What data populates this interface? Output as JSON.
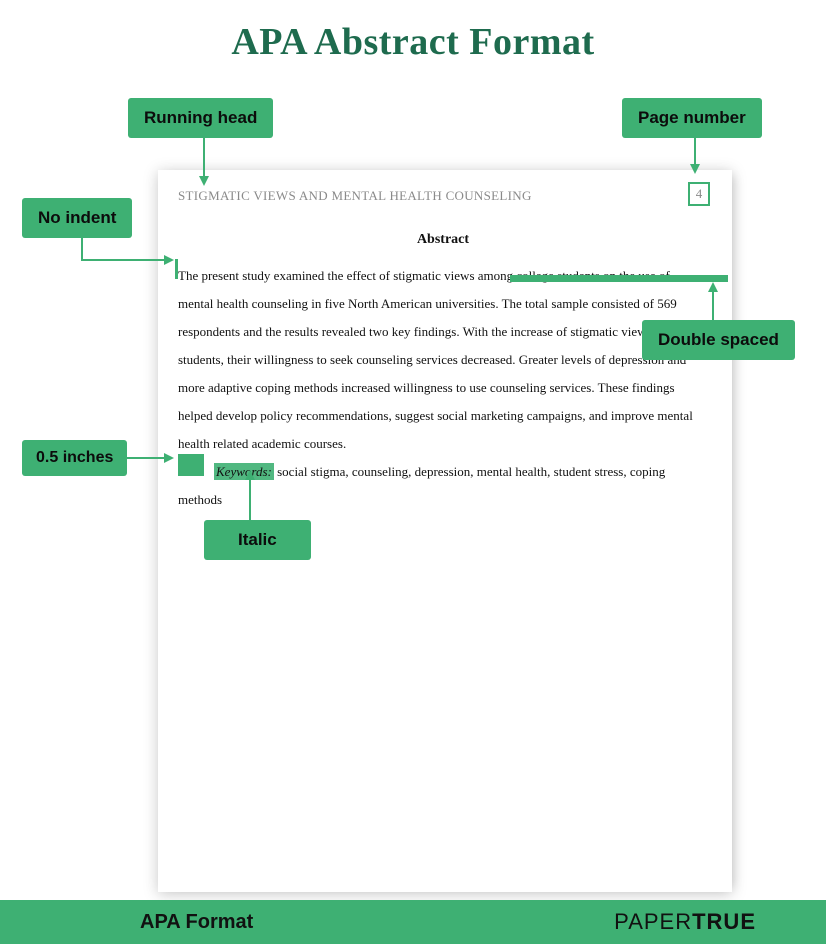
{
  "title": "APA Abstract Format",
  "page": {
    "running_head": "STIGMATIC VIEWS AND MENTAL HEALTH COUNSELING",
    "page_number": "4",
    "section_heading": "Abstract",
    "abstract_body": "The present study examined the effect of stigmatic views among college students on the use of mental health counseling in five North American universities. The total sample consisted of 569 respondents and the results revealed two key findings. With the increase of stigmatic views among students, their willingness to seek counseling services decreased. Greater levels of depression and more adaptive coping methods increased willingness to use counseling services. These findings helped develop policy recommendations, suggest social marketing campaigns, and improve mental health related academic courses.",
    "keywords_label": "Keywords:",
    "keywords_body": " social stigma, counseling, depression, mental health, student stress, coping methods"
  },
  "callouts": {
    "running_head": "Running head",
    "page_number": "Page number",
    "no_indent": "No indent",
    "double_spaced": "Double spaced",
    "half_inch": "0.5 inches",
    "italic": "Italic"
  },
  "footer": {
    "left": "APA Format",
    "brand1": "PAPER",
    "brand2": "TRUE"
  },
  "colors": {
    "accent": "#3eb073",
    "title": "#1e6b4e"
  }
}
